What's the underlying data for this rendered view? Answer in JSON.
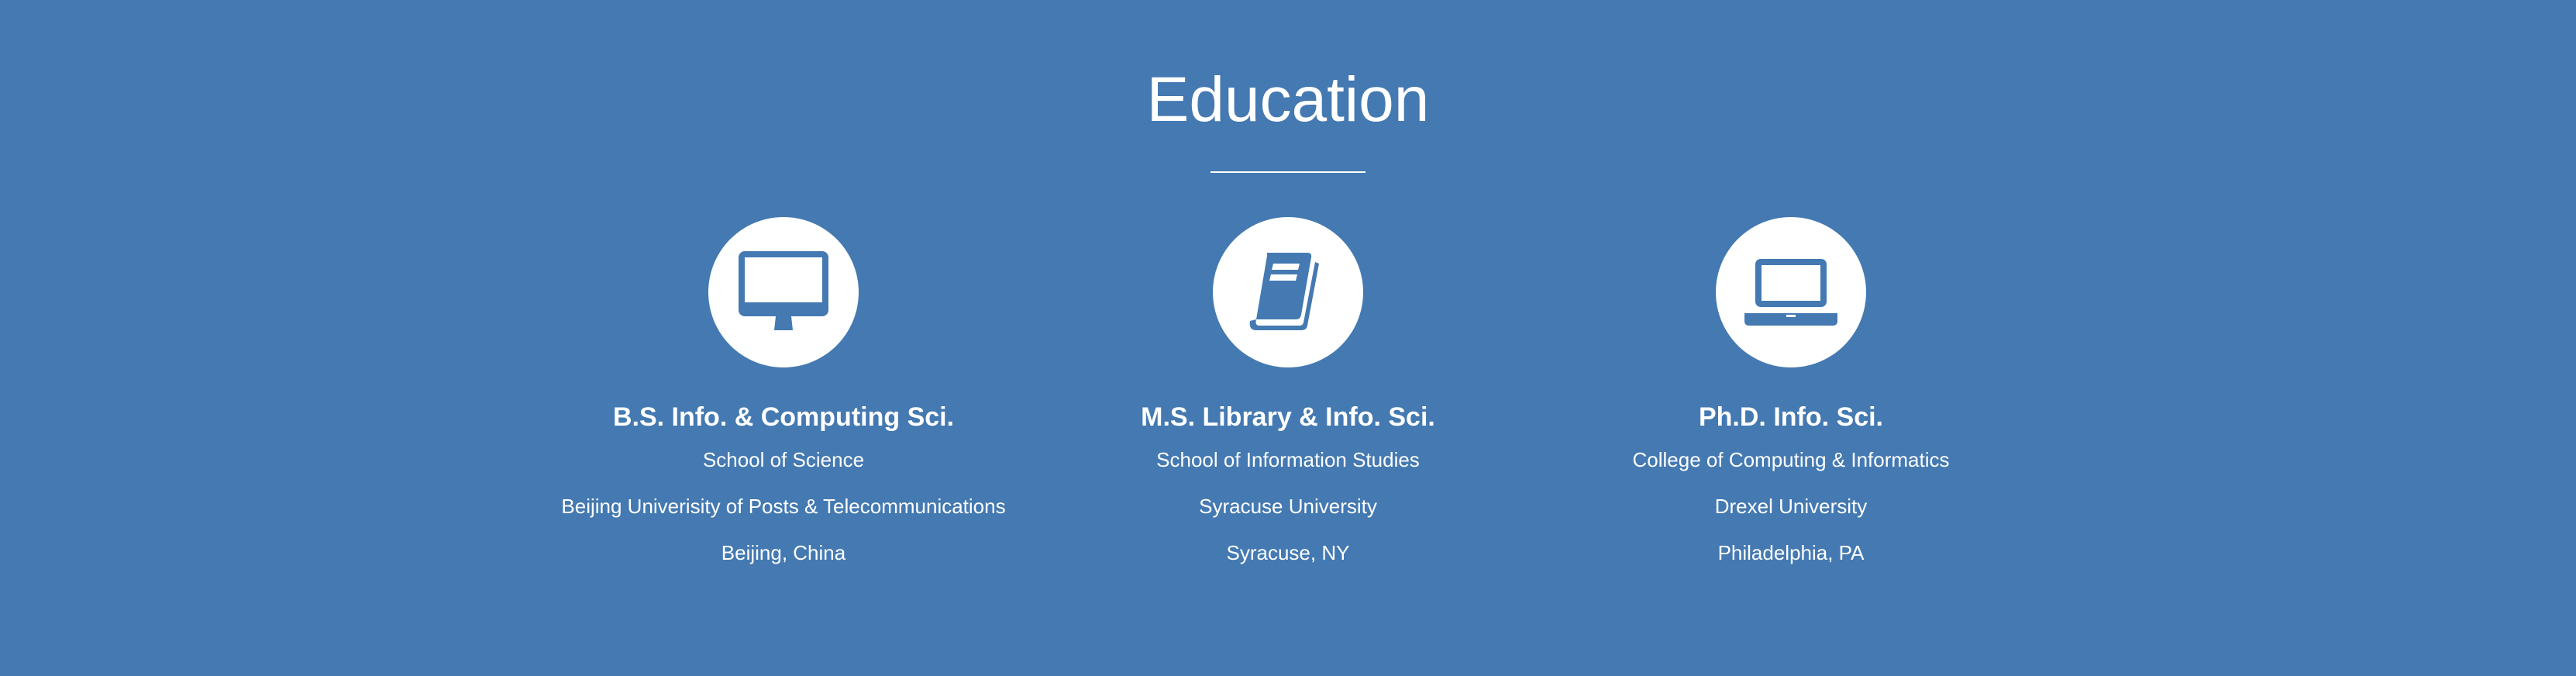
{
  "section": {
    "title": "Education"
  },
  "colors": {
    "background": "#4479b1",
    "foreground": "#ffffff"
  },
  "degrees": [
    {
      "icon": "desktop-icon",
      "degree": "B.S. Info. & Computing Sci.",
      "school": "School of Science",
      "university": "Beijing Univerisity of Posts & Telecommunications",
      "location": "Beijing, China"
    },
    {
      "icon": "book-icon",
      "degree": "M.S. Library & Info. Sci.",
      "school": "School of Information Studies",
      "university": "Syracuse University",
      "location": "Syracuse, NY"
    },
    {
      "icon": "laptop-icon",
      "degree": "Ph.D. Info. Sci.",
      "school": "College of Computing & Informatics",
      "university": "Drexel University",
      "location": "Philadelphia, PA"
    }
  ]
}
